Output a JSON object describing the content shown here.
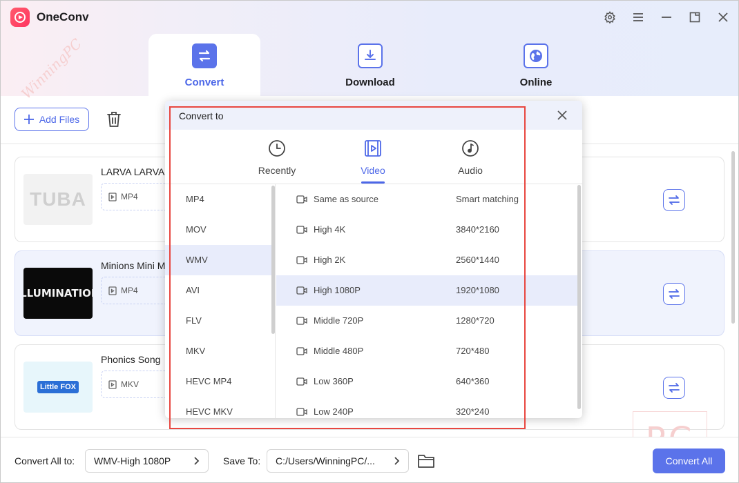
{
  "app": {
    "title": "OneConv"
  },
  "window_controls": [
    "gear-icon",
    "menu-icon",
    "minimize-icon",
    "maximize-icon",
    "close-icon"
  ],
  "tabs": [
    {
      "label": "Convert",
      "icon": "convert-icon",
      "active": true
    },
    {
      "label": "Download",
      "icon": "download-icon",
      "active": false
    },
    {
      "label": "Online",
      "icon": "globe-icon",
      "active": false
    }
  ],
  "toolbar": {
    "add_files_label": "Add Files"
  },
  "files": [
    {
      "title": "LARVA  LARVA",
      "format": "MP4",
      "thumb_text": "TUBA",
      "selected": false
    },
    {
      "title": "Minions Mini M",
      "format": "MP4",
      "thumb_text": "ILLUMINATION",
      "selected": true
    },
    {
      "title": "Phonics Song",
      "format": "MKV",
      "thumb_text": "Little FOX",
      "selected": false
    }
  ],
  "popup": {
    "title": "Convert to",
    "tabs": [
      {
        "label": "Recently",
        "icon": "clock-icon"
      },
      {
        "label": "Video",
        "icon": "video-icon",
        "active": true
      },
      {
        "label": "Audio",
        "icon": "music-icon"
      }
    ],
    "formats": [
      "MP4",
      "MOV",
      "WMV",
      "AVI",
      "FLV",
      "MKV",
      "HEVC MP4",
      "HEVC MKV"
    ],
    "selected_format": "WMV",
    "qualities": [
      {
        "name": "Same as source",
        "resolution": "Smart matching"
      },
      {
        "name": "High 4K",
        "resolution": "3840*2160"
      },
      {
        "name": "High 2K",
        "resolution": "2560*1440"
      },
      {
        "name": "High 1080P",
        "resolution": "1920*1080"
      },
      {
        "name": "Middle 720P",
        "resolution": "1280*720"
      },
      {
        "name": "Middle 480P",
        "resolution": "720*480"
      },
      {
        "name": "Low 360P",
        "resolution": "640*360"
      },
      {
        "name": "Low 240P",
        "resolution": "320*240"
      }
    ],
    "selected_quality": "High 1080P"
  },
  "footer": {
    "convert_all_to_label": "Convert All to:",
    "convert_all_to_value": "WMV-High 1080P",
    "save_to_label": "Save To:",
    "save_to_value": "C:/Users/WinningPC/...",
    "convert_all_button": "Convert All"
  },
  "watermark": {
    "corner": "PC",
    "side": "WinningPC"
  },
  "colors": {
    "accent": "#5b73ea",
    "highlight": "#e8463f",
    "selected_bg": "#e8ecfb"
  }
}
